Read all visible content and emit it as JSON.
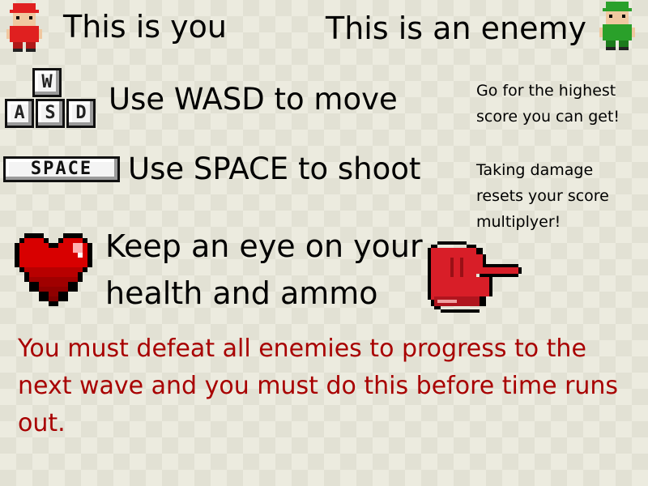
{
  "player": {
    "label": "This is you",
    "icon": "player-sprite-icon"
  },
  "enemy": {
    "label": "This is an enemy",
    "icon": "enemy-sprite-icon"
  },
  "move": {
    "label": "Use WASD to move",
    "keys": [
      "W",
      "A",
      "S",
      "D"
    ]
  },
  "shoot": {
    "label": "Use SPACE to shoot",
    "key": "SPACE"
  },
  "health": {
    "line1": "Keep an eye on your",
    "line2": "health and ammo"
  },
  "tips": {
    "score": "Go for the highest score you can get!",
    "damage": "Taking damage resets your score multiplyer!"
  },
  "goal": "You must defeat all enemies to progress to the next wave and you must do this before time runs out.",
  "colors": {
    "goal_text": "#a80000",
    "player": "#e02020",
    "enemy": "#2aa02a",
    "heart": "#d80000",
    "hand": "#d81e28"
  }
}
